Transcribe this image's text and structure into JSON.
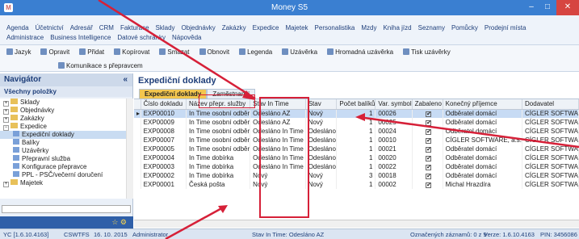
{
  "window": {
    "title": "Money S5",
    "minimize": "–",
    "maximize": "□",
    "close": "✕"
  },
  "menu": {
    "row1": [
      "Agenda",
      "Účetnictví",
      "Adresář",
      "CRM",
      "Fakturace",
      "Sklady",
      "Objednávky",
      "Zakázky",
      "Expedice",
      "Majetek",
      "Personalistika",
      "Mzdy",
      "Kniha jízd",
      "Seznamy",
      "Pomůcky",
      "Prodejní místa"
    ],
    "row2": [
      "Administrace",
      "Business Intelligence",
      "Datové schránky",
      "Nápověda"
    ]
  },
  "toolbar": {
    "row1": [
      "Jazyk",
      "Opravit",
      "Přidat",
      "Kopírovat",
      "Smazat",
      "Obnovit",
      "Legenda",
      "Uzávěrka",
      "Hromadná uzávěrka",
      "Tisk uzávěrky"
    ],
    "row2": [
      "Komunikace s přepravcem"
    ]
  },
  "navigator": {
    "title": "Navigátor",
    "collapse": "«",
    "subtitle": "Všechny položky",
    "tree": [
      {
        "label": "Sklady",
        "level": 0,
        "exp": "+"
      },
      {
        "label": "Objednávky",
        "level": 0,
        "exp": "+"
      },
      {
        "label": "Zakázky",
        "level": 0,
        "exp": "+"
      },
      {
        "label": "Expedice",
        "level": 0,
        "exp": "−"
      },
      {
        "label": "Expediční doklady",
        "level": 1,
        "selected": true
      },
      {
        "label": "Balíky",
        "level": 1
      },
      {
        "label": "Uzávěrky",
        "level": 1
      },
      {
        "label": "Přepravní služba",
        "level": 1
      },
      {
        "label": "Konfigurace přepravce",
        "level": 1
      },
      {
        "label": "PPL - PSČ/večerní doručení",
        "level": 1
      },
      {
        "label": "Majetek",
        "level": 0,
        "exp": "+"
      }
    ],
    "bottom_icons": "☆ ⚙"
  },
  "main": {
    "title": "Expediční doklady",
    "tabs": [
      "Expediční doklady",
      "Zaměstnanci"
    ],
    "columns": [
      "Číslo dokladu",
      "Název přepr. služby",
      "Stav In Time",
      "Stav",
      "Počet balíků",
      "Var. symbol",
      "Zabaleno",
      "Konečný příjemce",
      "Dodavatel"
    ],
    "rows": [
      [
        "EXP00010",
        "In Time osobní odběr",
        "Odesláno AZ",
        "Nový",
        "1",
        "00026",
        "✔",
        "Odběratel domácí",
        "CÍGLER SOFTWA"
      ],
      [
        "EXP00009",
        "In Time osobní odběr",
        "Odesláno AZ",
        "Nový",
        "1",
        "00025",
        "✔",
        "Odběratel domácí",
        "CÍGLER SOFTWA"
      ],
      [
        "EXP00008",
        "In Time osobní odběr",
        "Odesláno In Time",
        "Odesláno",
        "1",
        "00024",
        "✔",
        "Odběratel domácí",
        "CÍGLER SOFTWA"
      ],
      [
        "EXP00007",
        "In Time osobní odběr",
        "Odesláno In Time",
        "Odesláno",
        "1",
        "00010",
        "✔",
        "CÍGLER SOFTWARE, a.s.",
        "CÍGLER SOFTWA"
      ],
      [
        "EXP00005",
        "In Time osobní odběr",
        "Odesláno In Time",
        "Odesláno",
        "1",
        "00021",
        "✔",
        "Odběratel domácí",
        "CÍGLER SOFTWA"
      ],
      [
        "EXP00004",
        "In Time dobírka",
        "Odesláno In Time",
        "Odesláno",
        "1",
        "00020",
        "✔",
        "Odběratel domácí",
        "CÍGLER SOFTWA"
      ],
      [
        "EXP00003",
        "In Time dobírka",
        "Odesláno In Time",
        "Odesláno",
        "1",
        "00022",
        "✔",
        "Odběratel domácí",
        "CÍGLER SOFTWA"
      ],
      [
        "EXP00002",
        "In Time dobírka",
        "Nový",
        "Nový",
        "3",
        "00018",
        "✔",
        "Odběratel domácí",
        "CÍGLER SOFTWA"
      ],
      [
        "EXP00001",
        "Česká pošta",
        "Nový",
        "Nový",
        "1",
        "00002",
        "✔",
        "Michal Hrazdíra",
        "CÍGLER SOFTWA"
      ]
    ]
  },
  "status": {
    "version_left": "YC [1.6.10.4163]",
    "user": "CSWTFS",
    "date": "16. 10. 2015",
    "role": "Administrator",
    "center": "Stav In Time: Odesláno AZ",
    "count": "Označených záznamů: 0 z 9",
    "version": "Verze: 1.6.10.4163",
    "pin": "PIN: 3456086"
  },
  "colors": {
    "highlight": "#d62038",
    "titlebar": "#3a7fd1",
    "tab_active": "#f3c64e"
  }
}
